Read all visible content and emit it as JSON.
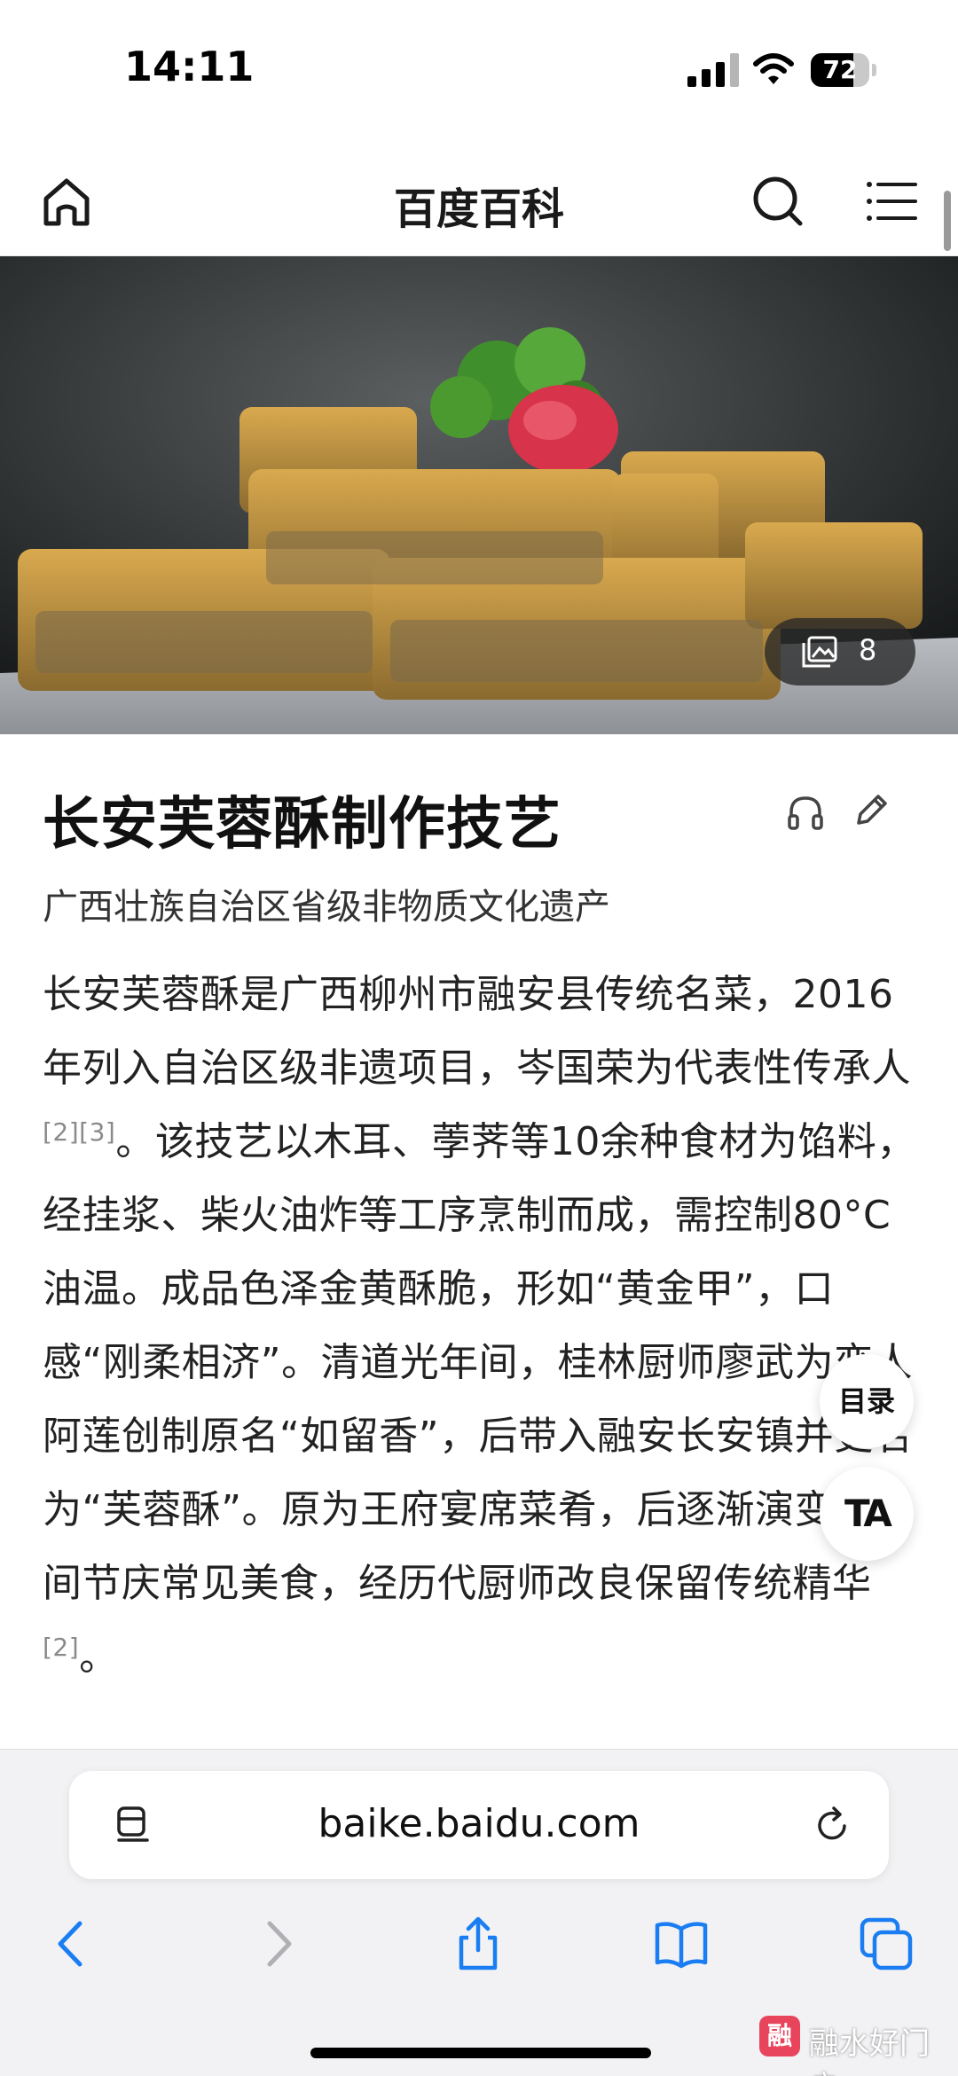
{
  "status_bar": {
    "time": "14:11",
    "battery_level": "72",
    "battery_fraction": 0.72
  },
  "nav": {
    "title": "百度百科",
    "icons": [
      "home-icon",
      "search-icon",
      "menu-icon"
    ]
  },
  "hero": {
    "gallery_count": "8",
    "icons": [
      "gallery-icon"
    ]
  },
  "article": {
    "title": "长安芙蓉酥制作技艺",
    "subtitle": "广西壮族自治区省级非物质文化遗产",
    "icons": [
      "audio-icon",
      "edit-icon"
    ],
    "body": {
      "part1": "长安芙蓉酥是广西柳州市融安县传统名菜，2016年列入自治区级非遗项目，岑国荣为代表性传承人",
      "ref1": "[2][3]",
      "part2": "。该技艺以木耳、荸荠等10余种食材为馅料，经挂浆、柴火油炸等工序烹制而成，需控制80°C油温。成品色泽金黄酥脆，形如“黄金甲”，口感“刚柔相济”。清道光年间，桂林厨师廖武为恋人阿莲创制原名“如留香”，后带入融安长安镇并更名为“芙蓉酥”。原为王府宴席菜肴，后逐渐演变为民间节庆常见美食，经历代厨师改良保留传统精华",
      "ref2": "[2]",
      "part3": "。"
    }
  },
  "floating": {
    "toc_label": "目录",
    "ta_label": "TA"
  },
  "browser": {
    "url": "baike.baidu.com",
    "icons": [
      "reader-icon",
      "reload-icon",
      "back-icon",
      "forward-icon",
      "share-icon",
      "bookmarks-icon",
      "tabs-icon"
    ]
  },
  "watermark": {
    "logo_text": "融",
    "text": "融水好门户"
  },
  "colors": {
    "accent": "#1a7ef2",
    "text": "#222222",
    "reference": "#8a8a8a"
  }
}
